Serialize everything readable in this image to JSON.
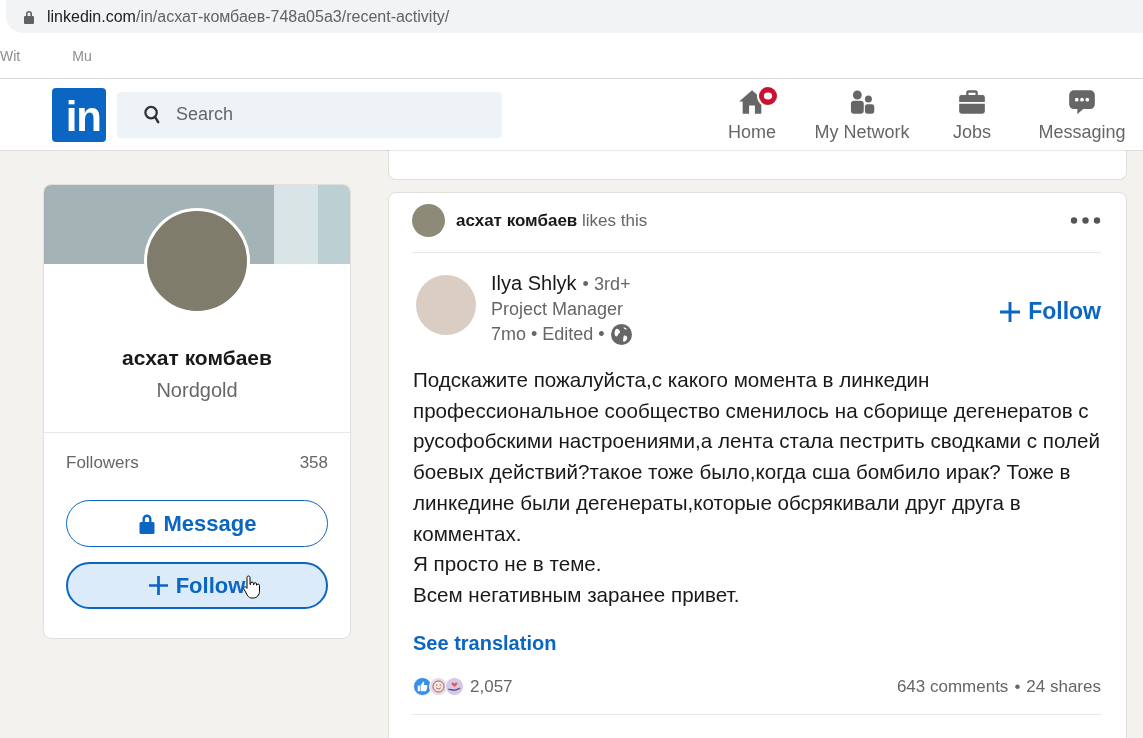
{
  "browser": {
    "url_host": "linkedin.com",
    "url_path": "/in/асхат-комбаев-748a05a3/recent-activity/",
    "bookmarks": [
      {
        "label": "Wit"
      },
      {
        "label": "Mu"
      }
    ]
  },
  "nav": {
    "logo": "in",
    "search": {
      "placeholder": "Search"
    },
    "items": [
      {
        "kind": "home",
        "label": "Home",
        "selected": false,
        "notification": true
      },
      {
        "kind": "network",
        "label": "My Network",
        "selected": false,
        "notification": false
      },
      {
        "kind": "jobs",
        "label": "Jobs",
        "selected": false,
        "notification": false
      },
      {
        "kind": "messaging",
        "label": "Messaging",
        "selected": false,
        "notification": false
      }
    ]
  },
  "profile": {
    "name": "асхат комбаев",
    "company": "Nordgold",
    "stats": [
      {
        "label": "Followers",
        "value": "358"
      }
    ],
    "buttons": [
      {
        "kind": "message",
        "label": "Message",
        "hovered": false
      },
      {
        "kind": "follow",
        "label": "Follow",
        "hovered": true
      }
    ]
  },
  "post": {
    "activity": {
      "actor": "асхат комбаев",
      "action": "likes this"
    },
    "author": {
      "name": "Ilya Shlyk",
      "degree": "• 3rd+",
      "headline": "Project Manager",
      "meta": "7mo • Edited •"
    },
    "follow_label": "Follow",
    "paragraphs": [
      "Подскажите пожалуйста,с какого момента в линкедин профессиональное сообщество сменилось на сборище дегенератов с русофобскими настроениями,а лента стала пестрить сводками с полей боевых действий?такое тоже было,когда сша бомбило ирак? Тоже в линкедине были дегенераты,которые обсрякивали друг друга в комментах.",
      "Я просто не в теме.",
      "Всем негативным заранее привет."
    ],
    "translation_link": "See translation",
    "reactions": {
      "items": [
        {
          "kind": "like"
        },
        {
          "kind": "funny"
        },
        {
          "kind": "support"
        }
      ],
      "count": "2,057"
    },
    "comments": "643 comments",
    "separator": "•",
    "shares": "24 shares"
  }
}
